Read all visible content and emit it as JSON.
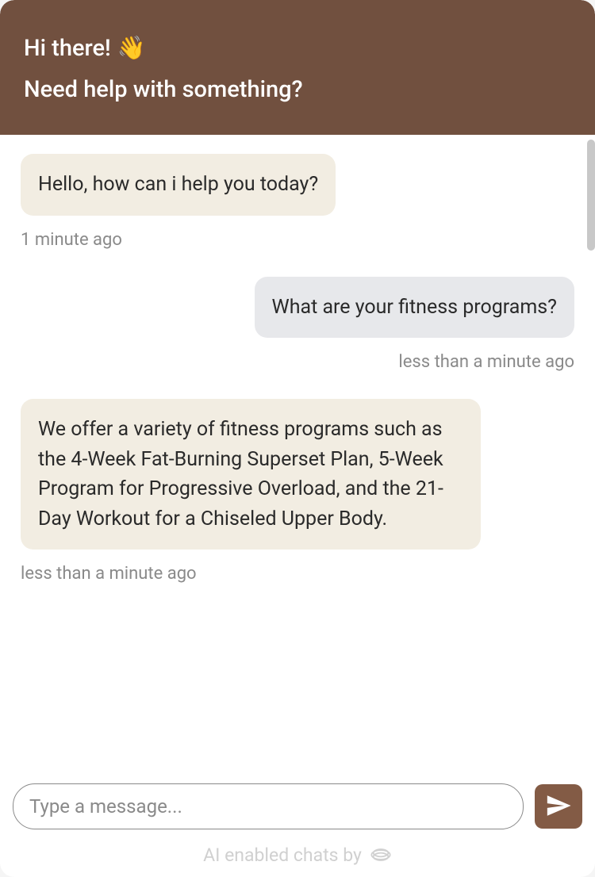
{
  "header": {
    "greeting": "Hi there!",
    "wave_emoji": "👋",
    "subtitle": "Need help with something?"
  },
  "messages": [
    {
      "role": "bot",
      "text": "Hello, how can i help you today?",
      "timestamp": "1 minute ago"
    },
    {
      "role": "user",
      "text": "What are your fitness programs?",
      "timestamp": "less than a minute ago"
    },
    {
      "role": "bot",
      "text": "We offer a variety of fitness programs such as the 4-Week Fat-Burning Superset Plan, 5-Week Program for Progressive Overload, and the 21-Day Workout for a Chiseled Upper Body.",
      "timestamp": "less than a minute ago"
    }
  ],
  "input": {
    "placeholder": "Type a message..."
  },
  "footer": {
    "text": "AI enabled chats by"
  }
}
